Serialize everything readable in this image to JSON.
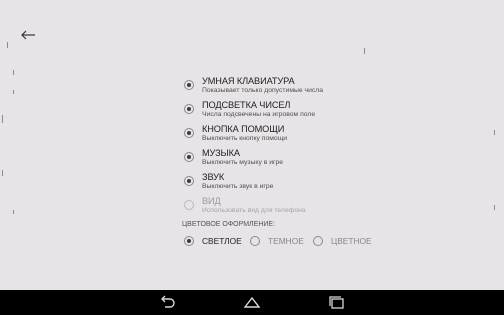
{
  "settings": {
    "items": [
      {
        "title": "УМНАЯ КЛАВИАТУРА",
        "subtitle": "Показывает только допустимые числа",
        "checked": true,
        "enabled": true
      },
      {
        "title": "ПОДСВЕТКА ЧИСЕЛ",
        "subtitle": "Числа подсвечены на игровом поле",
        "checked": true,
        "enabled": true
      },
      {
        "title": "КНОПКА ПОМОЩИ",
        "subtitle": "Выключить кнопку помощи",
        "checked": true,
        "enabled": true
      },
      {
        "title": "МУЗЫКА",
        "subtitle": "Выключить музыку в игре",
        "checked": true,
        "enabled": true
      },
      {
        "title": "ЗВУК",
        "subtitle": "Выключить звук в игре",
        "checked": true,
        "enabled": true
      },
      {
        "title": "ВИД",
        "subtitle": "Использовать вид для телефона",
        "checked": false,
        "enabled": false
      }
    ],
    "theme_label": "ЦВЕТОВОЕ ОФОРМЛЕНИЕ:",
    "theme_options": [
      {
        "label": "СВЕТЛОЕ",
        "selected": true
      },
      {
        "label": "ТЕМНОЕ",
        "selected": false
      },
      {
        "label": "ЦВЕТНОЕ",
        "selected": false
      }
    ]
  },
  "icons": {
    "back": "back-arrow-icon",
    "nav_back": "nav-back-icon",
    "nav_home": "nav-home-icon",
    "nav_recents": "nav-recents-icon"
  },
  "colors": {
    "background": "#e8e3e6",
    "navbar": "#000000",
    "text_primary": "#1f1f1f",
    "text_disabled": "#9e9a9c"
  }
}
